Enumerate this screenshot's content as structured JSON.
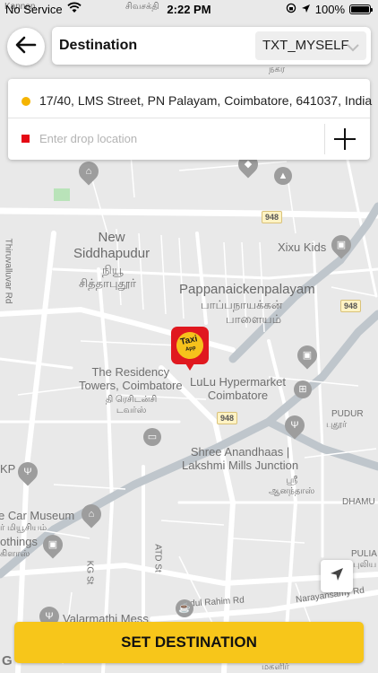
{
  "status_bar": {
    "carrier": "No Service",
    "time": "2:22 PM",
    "battery": "100%",
    "battery_level": 1.0
  },
  "header": {
    "title": "Destination",
    "profile_selected": "TXT_MYSELF"
  },
  "address": {
    "pickup": "17/40, LMS Street, PN Palayam, Coimbatore, 641037, India",
    "drop_value": "",
    "drop_placeholder": "Enter drop location"
  },
  "map": {
    "labels": {
      "new_siddhapudur": "New\nSiddhapudur",
      "new_siddhapudur_ta1": "நியூ",
      "new_siddhapudur_ta2": "சித்தாபுதூர்",
      "pappanaickenpalayam": "Pappanaickenpalayam",
      "pappanaickenpalayam_ta1": "பாப்பநாயக்கன்",
      "pappanaickenpalayam_ta2": "பாளையம்",
      "xixu_kids": "Xixu Kids",
      "thiruvalluvar_rd": "Thiruvalluvar Rd",
      "residency_towers": "The Residency\nTowers, Coimbatore",
      "residency_towers_ta": "தி ரெசிடன்சி\nடவர்ஸ்",
      "lulu": "LuLu Hypermarket\nCoimbatore",
      "pudur": "PUDUR",
      "pudur_ta": "புதூர்",
      "shree_anandhaas": "Shree Anandhaas |\nLakshmi Mills Junction",
      "shree_anandhaas_ta": "ஸ்ரீ\nஆனந்தாஸ்",
      "dhamu_n": "DHAMU N",
      "car_museum": "e Car Museum",
      "car_museum_ta": "ர் மியூசியம்",
      "kp": "KP",
      "clothings": "othings",
      "clothings_ta": "கிளாஸ்",
      "atd_st": "ATD St",
      "kg_st": "KG St",
      "pulia": "PULIA",
      "pulia_ta": "புலிய",
      "abdul_rahim_rd": "Abdul Rahim Rd",
      "narayansamy_rd": "Narayansamy Rd",
      "valarmathi": "Valarmathi Mess",
      "magalir": "மகளிர்",
      "kannan_top": "Kannan",
      "nagar_ta": "நகர",
      "ta_top": "சிவசக்தி"
    },
    "road_shields": [
      "948",
      "948",
      "948"
    ],
    "marker_text": "Taxi",
    "marker_sub": "App"
  },
  "actions": {
    "set_destination": "SET DESTINATION"
  },
  "colors": {
    "accent": "#f7c61a",
    "pickup_dot": "#f5b400",
    "drop_square": "#e50914",
    "marker": "#e0181f"
  },
  "icons": {
    "back": "arrow-left-icon",
    "chevron": "chevron-down-icon",
    "add": "plus-icon",
    "locate": "navigation-arrow-icon"
  }
}
